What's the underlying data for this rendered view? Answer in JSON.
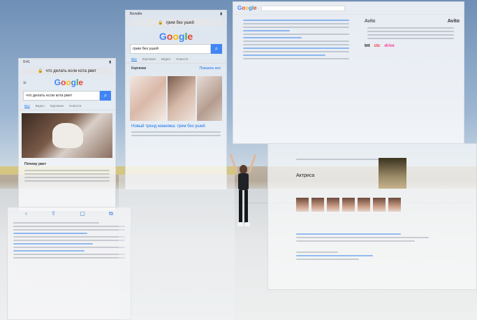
{
  "phone_left": {
    "status_time": "9:41",
    "url": "что делать если кота рвет",
    "logo": [
      "G",
      "o",
      "o",
      "g",
      "l",
      "e"
    ],
    "query": "что делать если кота рвет",
    "tabs": [
      "Все",
      "Видео",
      "Картинки",
      "Новости"
    ],
    "result_title": "Почему рвет"
  },
  "phone_center": {
    "carrier": "Билайн",
    "url": "грим без ушей",
    "logo": [
      "G",
      "o",
      "o",
      "g",
      "l",
      "e"
    ],
    "query": "грим без ушей",
    "tabs": [
      "Все",
      "Картинки",
      "Видео",
      "Новости"
    ],
    "section_label": "Картинки",
    "section_more": "Показать все",
    "result_link": "Новый тренд макияжа: грим без ушей"
  },
  "desktop_top": {
    "logo": [
      "G",
      "o",
      "o",
      "g",
      "l",
      "e"
    ],
    "kp_name": "Avito",
    "kp_logo_text": "Avito",
    "brands": [
      "tnt",
      "ctc",
      "drive"
    ]
  },
  "desktop_bottom": {
    "knowledge_name": "Актриса",
    "face_count": 7
  },
  "colors": {
    "google_blue": "#4285f4",
    "google_red": "#ea4335",
    "google_yellow": "#fbbc05",
    "google_green": "#34a853",
    "link": "#1a0dab"
  }
}
